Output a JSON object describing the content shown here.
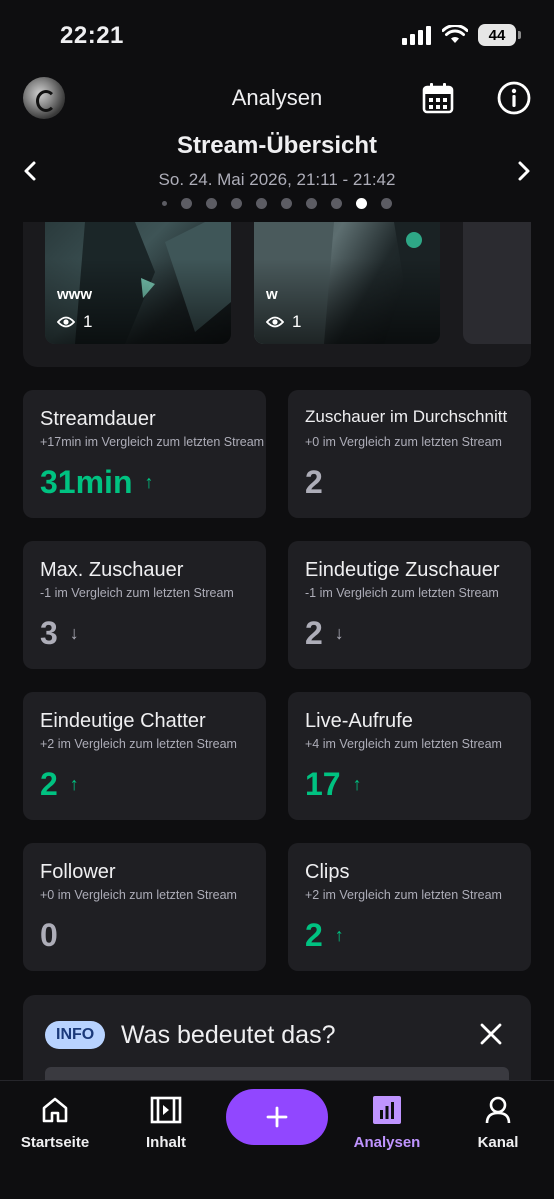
{
  "status_bar": {
    "time": "22:21",
    "battery": "44"
  },
  "nav": {
    "title": "Analysen"
  },
  "overview": {
    "title": "Stream-Übersicht",
    "date": "So. 24. Mai 2026, 21:11 - 21:42",
    "page_count": 10,
    "active_page": 9
  },
  "clips": [
    {
      "title": "www",
      "views": "1"
    },
    {
      "title": "w",
      "views": "1"
    }
  ],
  "stats": [
    {
      "title": "Streamdauer",
      "subtitle": "+17min im Vergleich zum letzten Stream",
      "value": "31min",
      "trend": "up"
    },
    {
      "title": "Zuschauer im Durchschnitt",
      "subtitle": "+0 im Vergleich zum letzten Stream",
      "value": "2",
      "trend": "none"
    },
    {
      "title": "Max. Zuschauer",
      "subtitle": "-1 im Vergleich zum letzten Stream",
      "value": "3",
      "trend": "down"
    },
    {
      "title": "Eindeutige Zuschauer",
      "subtitle": "-1 im Vergleich zum letzten Stream",
      "value": "2",
      "trend": "down"
    },
    {
      "title": "Eindeutige Chatter",
      "subtitle": "+2 im Vergleich zum letzten Stream",
      "value": "2",
      "trend": "up"
    },
    {
      "title": "Live-Aufrufe",
      "subtitle": "+4 im Vergleich zum letzten Stream",
      "value": "17",
      "trend": "up"
    },
    {
      "title": "Follower",
      "subtitle": "+0 im Vergleich zum letzten Stream",
      "value": "0",
      "trend": "none"
    },
    {
      "title": "Clips",
      "subtitle": "+2 im Vergleich zum letzten Stream",
      "value": "2",
      "trend": "up"
    }
  ],
  "info": {
    "badge": "INFO",
    "question": "Was bedeutet das?"
  },
  "tabs": [
    {
      "label": "Startseite",
      "icon": "home-icon"
    },
    {
      "label": "Inhalt",
      "icon": "content-icon"
    },
    {
      "label": "Analysen",
      "icon": "analytics-icon",
      "active": true
    },
    {
      "label": "Kanal",
      "icon": "profile-icon"
    }
  ],
  "colors": {
    "accent": "#9147ff",
    "positive": "#00c281",
    "neutral": "#adadb8",
    "active_tab": "#bf94ff",
    "info_badge": "#b8d3ff"
  }
}
